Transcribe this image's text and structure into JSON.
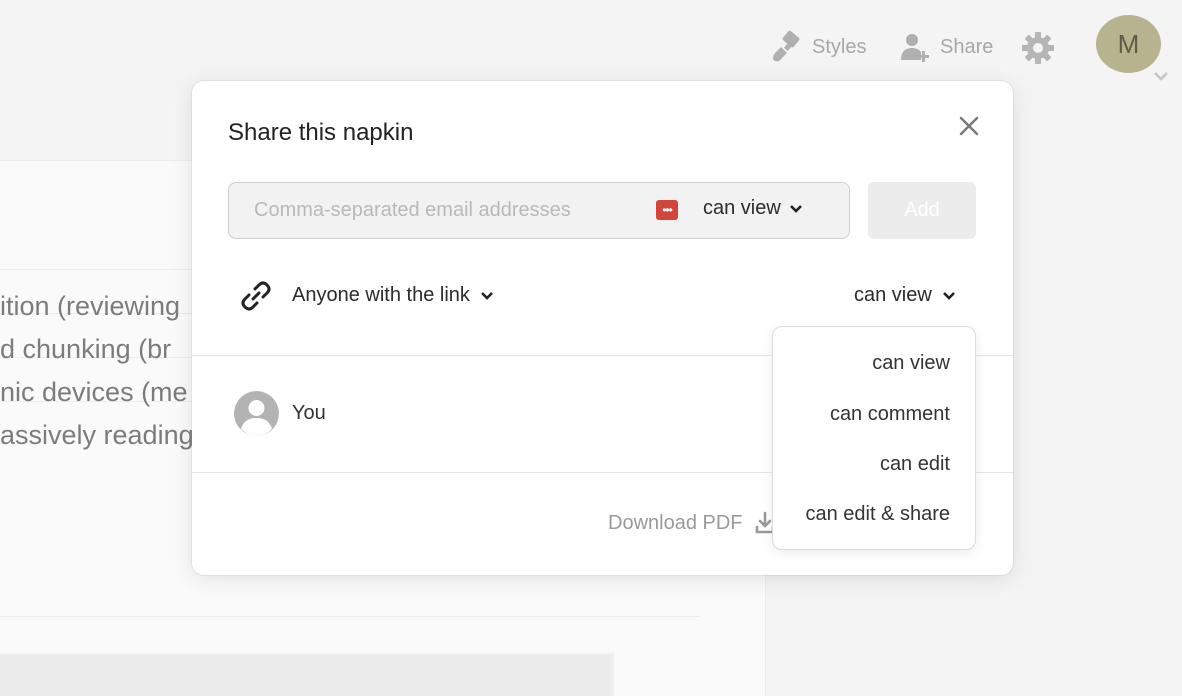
{
  "header": {
    "styles_label": "Styles",
    "share_label": "Share",
    "avatar_initial": "M"
  },
  "document": {
    "lines": [
      "ition (reviewing",
      "d chunking (br",
      "nic devices (me",
      "assively reading."
    ]
  },
  "share_modal": {
    "title": "Share this napkin",
    "email_placeholder": "Comma-separated email addresses",
    "invite_permission": "can view",
    "add_label": "Add",
    "link_scope": "Anyone with the link",
    "link_permission": "can view",
    "members": [
      {
        "name": "You"
      }
    ],
    "download_label": "Download PDF"
  },
  "permission_menu": {
    "options": [
      "can view",
      "can comment",
      "can edit",
      "can edit & share"
    ]
  },
  "colors": {
    "avatar_bg": "#b8b38f",
    "password_icon": "#d1453b",
    "add_button_disabled": "#ececec"
  },
  "icons": [
    "paint-brush-icon",
    "add-user-icon",
    "gear-icon",
    "chevron-down-icon",
    "close-icon",
    "password-manager-icon",
    "link-icon",
    "user-avatar-icon",
    "download-icon"
  ]
}
